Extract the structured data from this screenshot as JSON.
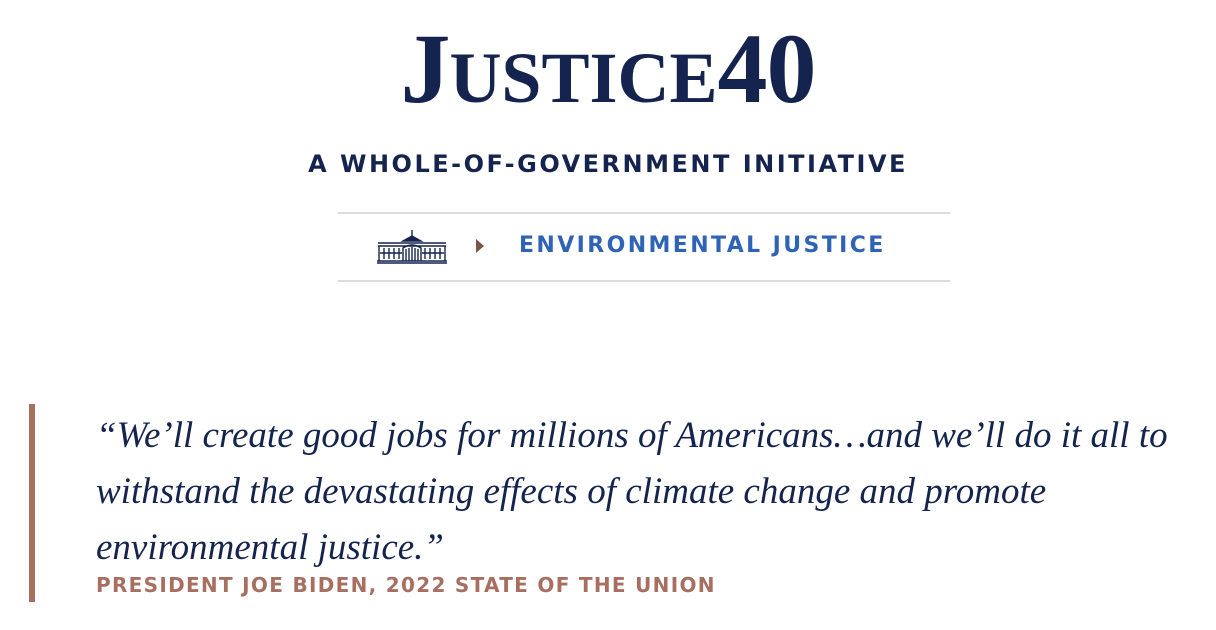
{
  "header": {
    "logo": {
      "j": "J",
      "ustice": "USTICE",
      "number": "40"
    },
    "tagline": "A WHOLE-OF-GOVERNMENT INITIATIVE"
  },
  "breadcrumb": {
    "home_icon": "white-house-icon",
    "separator_icon": "caret-right-icon",
    "current_label": "ENVIRONMENTAL JUSTICE"
  },
  "quote": {
    "text": "“We’ll create good jobs for millions of Americans…and we’ll do it all to withstand the devastating effects of climate change and promote environmental justice.”",
    "citation": "PRESIDENT JOE BIDEN, 2022 STATE OF THE UNION"
  },
  "colors": {
    "navy": "#15244e",
    "link_blue": "#2f63b5",
    "accent_brown": "#a86f61",
    "divider": "#dcdcdc"
  }
}
